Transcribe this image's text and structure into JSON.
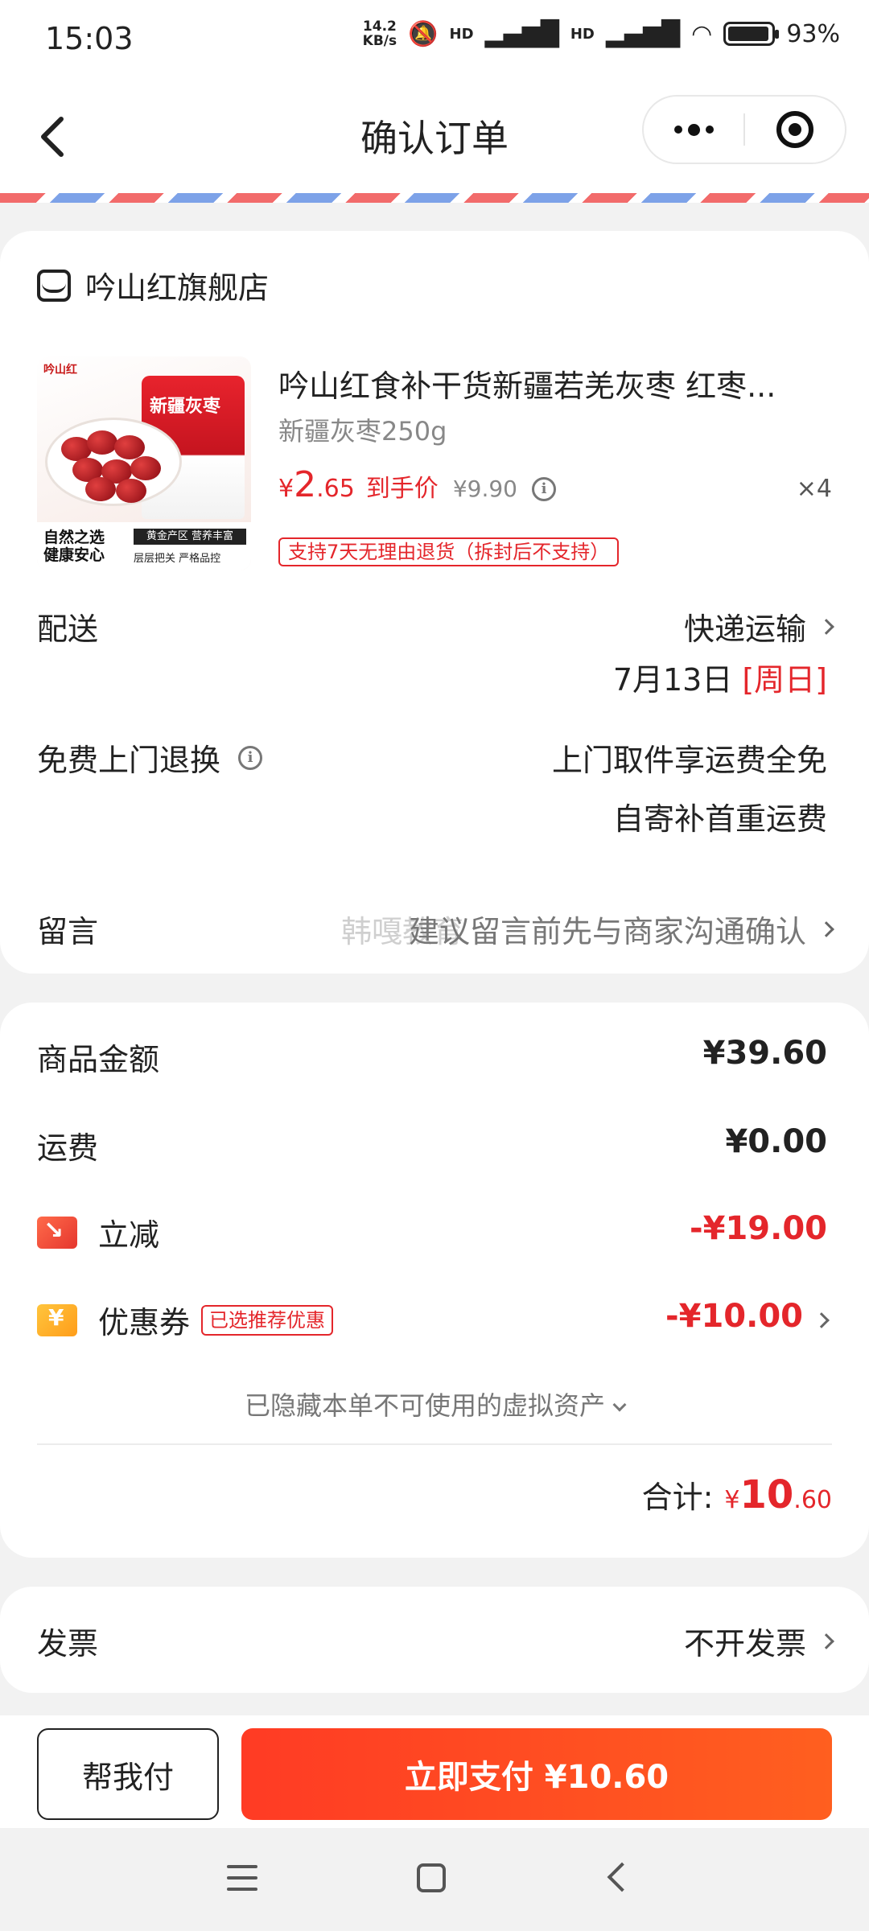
{
  "status_bar": {
    "time": "15:03",
    "net_speed": "14.2",
    "net_unit": "KB/s",
    "signal1": "HD",
    "signal2": "HD",
    "battery": "93%"
  },
  "nav": {
    "title": "确认订单"
  },
  "order": {
    "shop_name": "吟山红旗舰店",
    "product": {
      "title": "吟山红食补干货新疆若羌灰枣 红枣...",
      "spec": "新疆灰枣250g",
      "price_symbol": "¥",
      "price_int": "2",
      "price_dec": ".65",
      "price_label": "到手价",
      "original_price": "¥9.90",
      "quantity": "×4",
      "return_policy": "支持7天无理由退货（拆封后不支持）",
      "image_brand": "吟山红",
      "image_bag_text": "新疆灰枣",
      "image_slogan_1": "自然之选",
      "image_slogan_2": "健康安心",
      "image_band": "黄金产区 营养丰富",
      "image_quality": "层层把关 严格品控"
    },
    "delivery": {
      "label": "配送",
      "method": "快递运输",
      "date": "7月13日",
      "weekday": "[周日]"
    },
    "free_return": {
      "label": "免费上门退换",
      "line1": "上门取件享运费全免",
      "line2": "自寄补首重运费"
    },
    "message": {
      "label": "留言",
      "placeholder": "建议留言前先与商家沟通确认",
      "watermark": "韩嘎教育"
    }
  },
  "summary": {
    "goods_label": "商品金额",
    "goods_value": "¥39.60",
    "shipping_label": "运费",
    "shipping_value": "¥0.00",
    "discount_label": "立减",
    "discount_value": "-¥19.00",
    "coupon_label": "优惠券",
    "coupon_tag": "已选推荐优惠",
    "coupon_value": "-¥10.00",
    "hidden_assets": "已隐藏本单不可使用的虚拟资产",
    "total_label": "合计:",
    "total_symbol": "¥",
    "total_int": "10",
    "total_dec": ".60"
  },
  "invoice": {
    "label": "发票",
    "value": "不开发票"
  },
  "actions": {
    "help_pay": "帮我付",
    "pay_now": "立即支付 ¥10.60"
  },
  "colors": {
    "accent_red": "#e4262b",
    "pay_gradient_start": "#ff3b24",
    "pay_gradient_end": "#ff5f1f"
  }
}
